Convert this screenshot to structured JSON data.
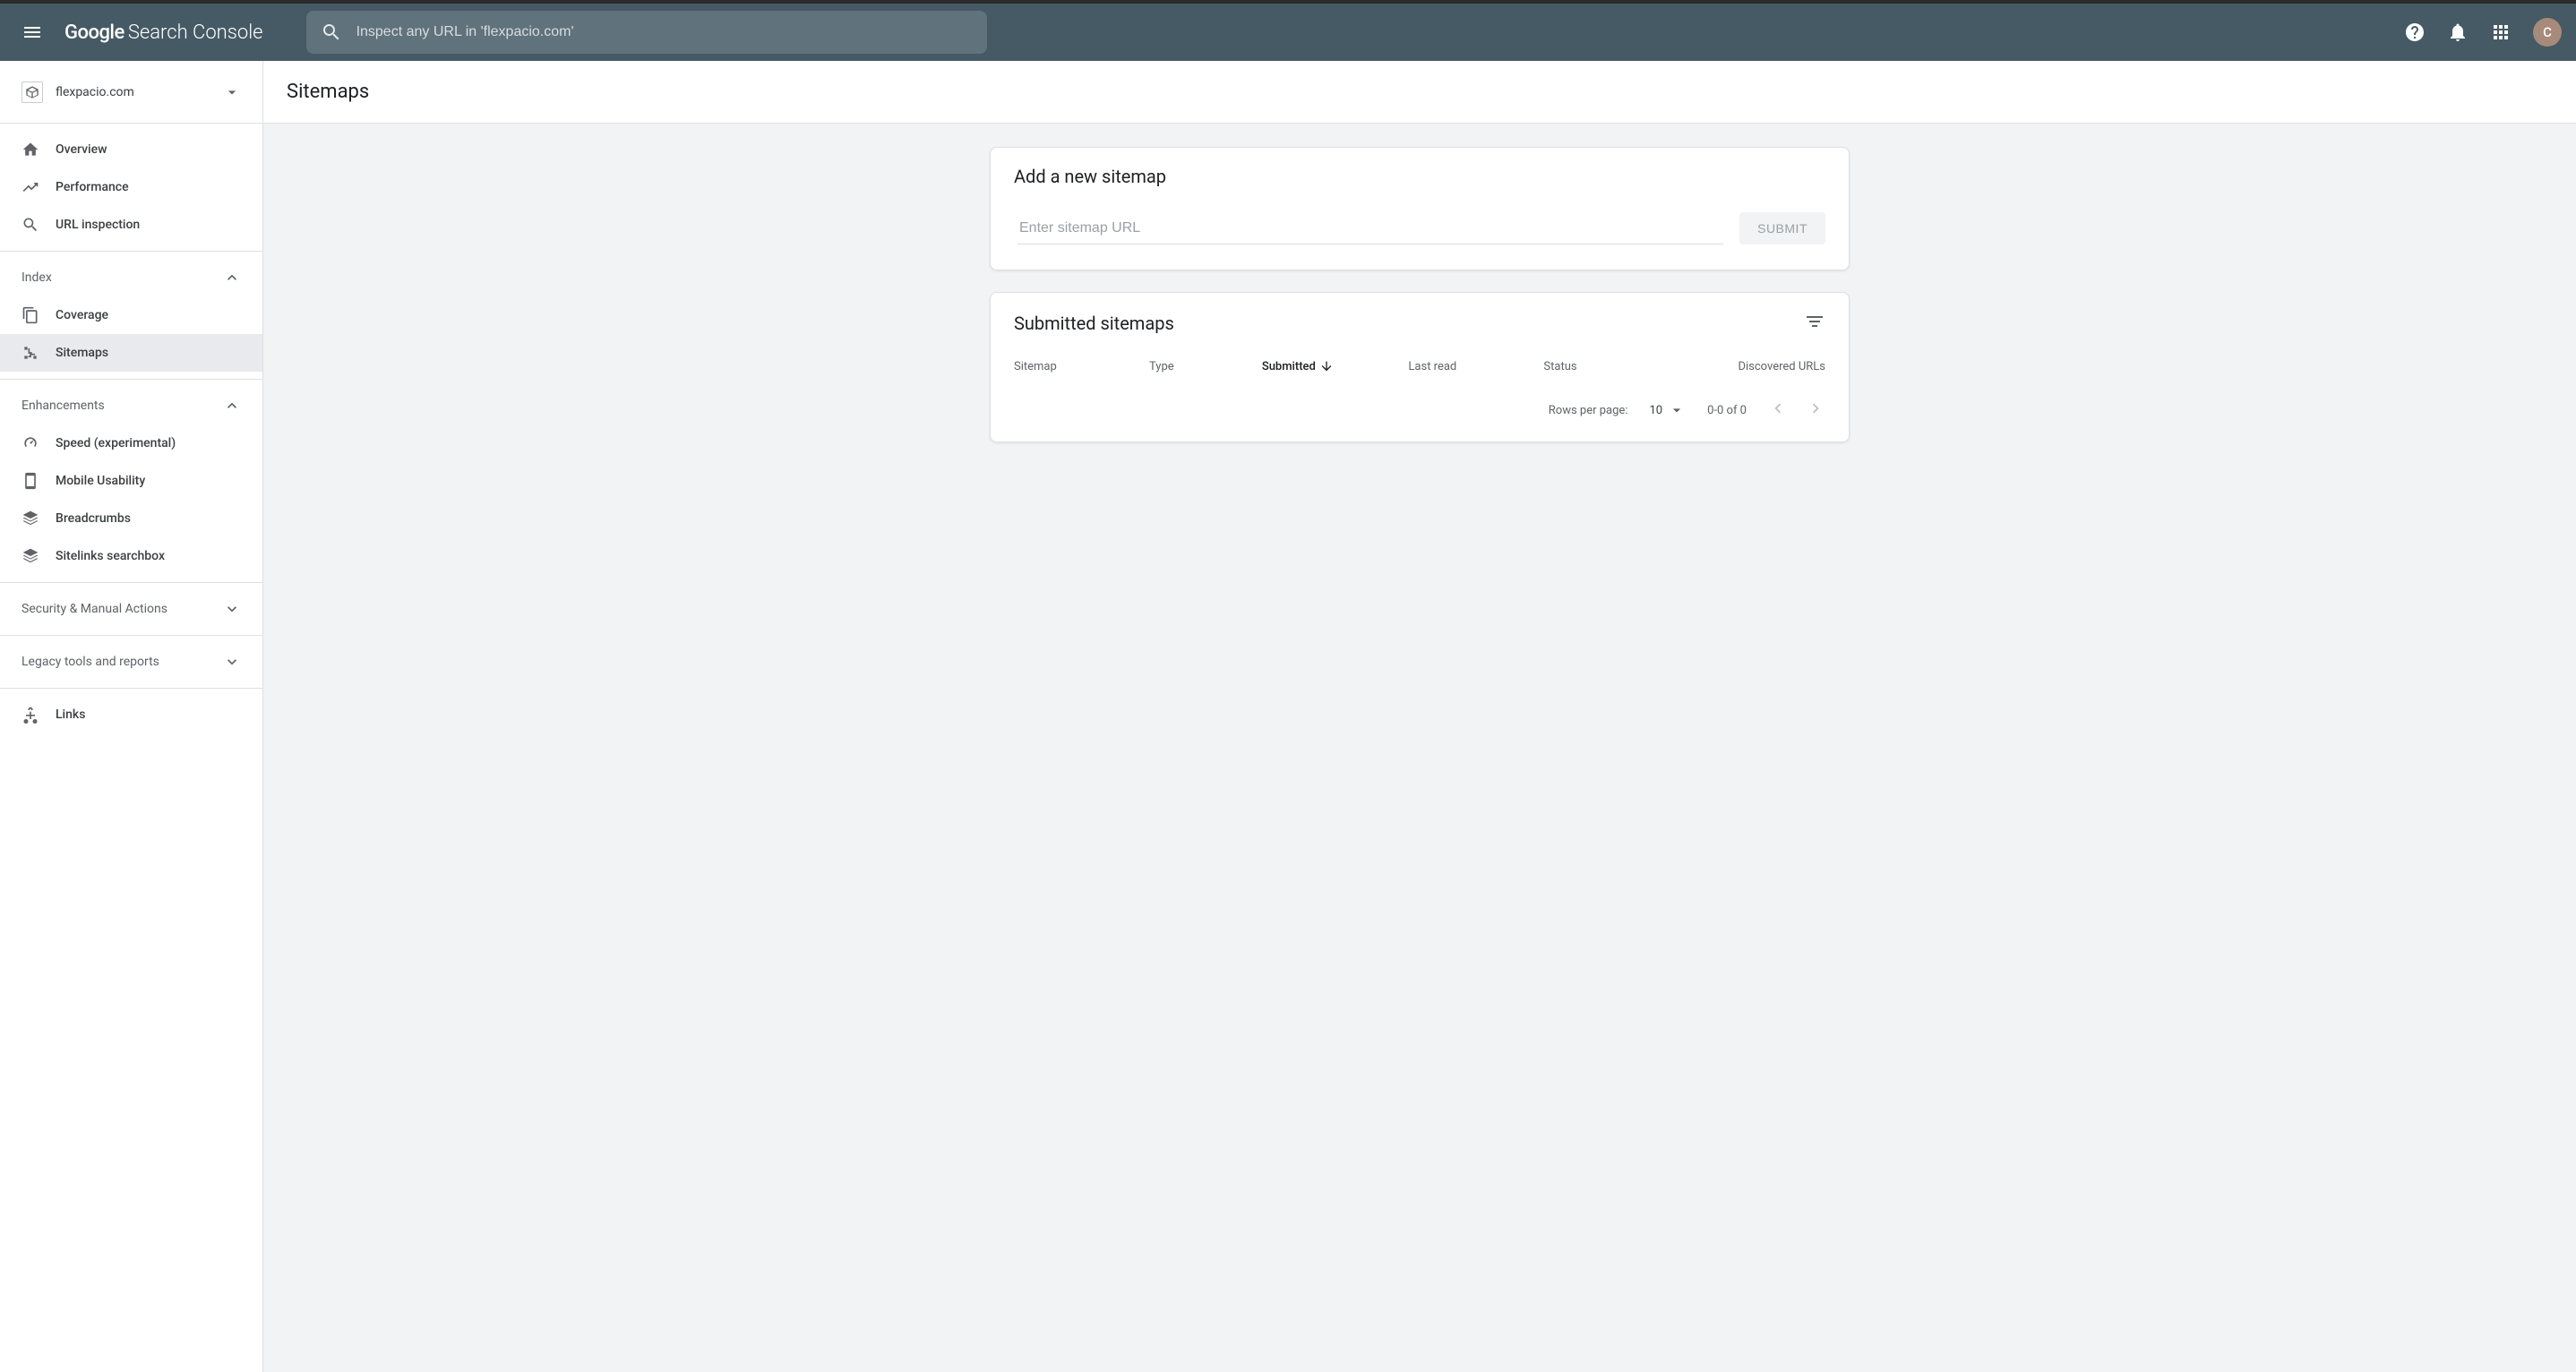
{
  "header": {
    "logo_google": "Google",
    "logo_product": "Search Console",
    "search_placeholder": "Inspect any URL in 'flexpacio.com'",
    "avatar_letter": "C"
  },
  "property": {
    "name": "flexpacio.com"
  },
  "sidebar": {
    "overview": "Overview",
    "performance": "Performance",
    "url_inspection": "URL inspection",
    "index_header": "Index",
    "coverage": "Coverage",
    "sitemaps": "Sitemaps",
    "enhancements_header": "Enhancements",
    "speed": "Speed (experimental)",
    "mobile": "Mobile Usability",
    "breadcrumbs": "Breadcrumbs",
    "sitelinks": "Sitelinks searchbox",
    "security_header": "Security & Manual Actions",
    "legacy_header": "Legacy tools and reports",
    "links": "Links"
  },
  "page": {
    "title": "Sitemaps"
  },
  "add_card": {
    "title": "Add a new sitemap",
    "input_placeholder": "Enter sitemap URL",
    "submit": "SUBMIT"
  },
  "table_card": {
    "title": "Submitted sitemaps",
    "columns": {
      "sitemap": "Sitemap",
      "type": "Type",
      "submitted": "Submitted",
      "last_read": "Last read",
      "status": "Status",
      "discovered": "Discovered URLs"
    },
    "footer": {
      "rows_label": "Rows per page:",
      "rows_value": "10",
      "range": "0-0 of 0"
    }
  }
}
